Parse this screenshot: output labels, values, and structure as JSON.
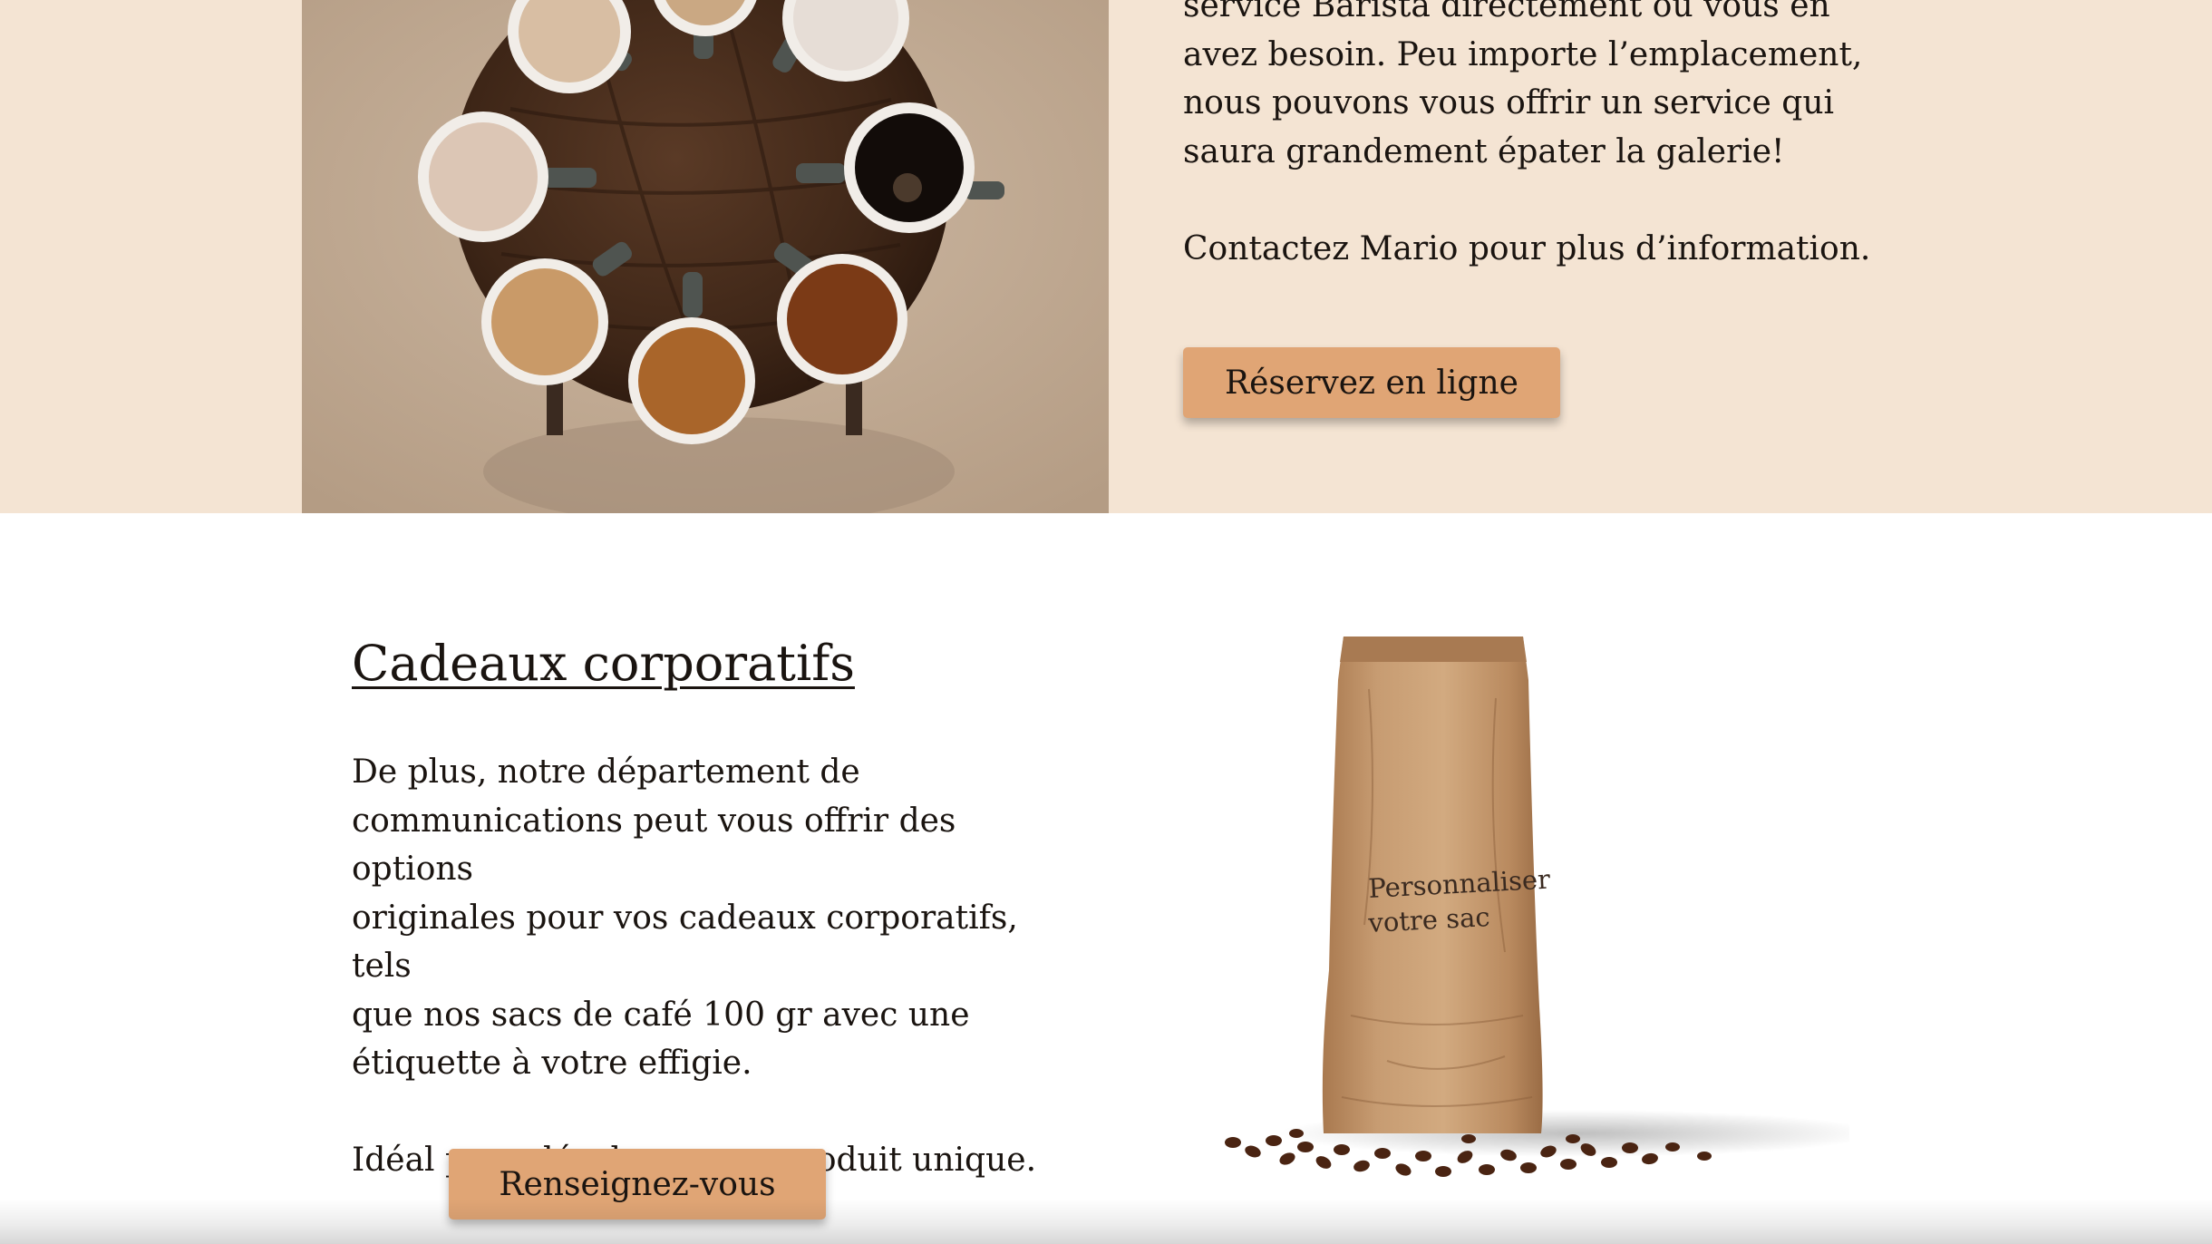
{
  "barista_section": {
    "paragraph_lines": [
      "service Barista directement où vous en",
      "avez besoin. Peu importe l’emplacement,",
      "nous pouvons vous offrir un service qui",
      "saura grandement épater la galerie!"
    ],
    "contact_text": "Contactez Mario pour plus d’information.",
    "button_label": "Réservez en ligne",
    "photo_icon": "coffee-cups-photo"
  },
  "corporate_section": {
    "title": "Cadeaux corporatifs",
    "paragraph_lines": [
      "De plus, notre département de",
      "communications peut vous offrir des options",
      "originales pour vos cadeaux corporatifs, tels",
      "que nos sacs de café 100 gr avec une",
      "étiquette à votre effigie."
    ],
    "tagline": "Idéal pour développer un produit unique.",
    "button_label": "Renseignez-vous",
    "bag_label_line1": "Personnaliser",
    "bag_label_line2": "votre sac",
    "photo_icon": "coffee-bag-photo"
  },
  "colors": {
    "band_background": "#f4e4d3",
    "button_background": "#e0a575",
    "text": "#1a1410",
    "page_background": "#ffffff"
  }
}
